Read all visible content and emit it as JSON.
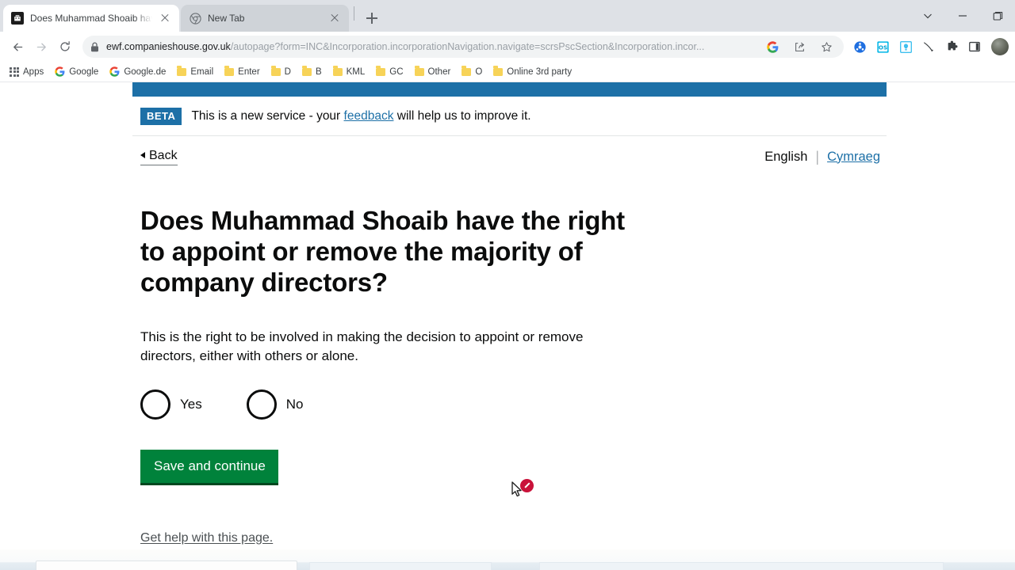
{
  "browser": {
    "tabs": [
      {
        "title": "Does Muhammad Shoaib have t",
        "favicon": "companies-house-icon",
        "active": true
      },
      {
        "title": "New Tab",
        "favicon": "chrome-icon",
        "active": false
      }
    ],
    "new_tab_label": "+",
    "window_controls": [
      "chevron-down-icon",
      "minimize-icon",
      "maximize-icon"
    ],
    "nav": {
      "back": "back-arrow-icon",
      "forward": "forward-arrow-icon",
      "reload": "reload-icon"
    },
    "omnibox": {
      "lock": "lock-icon",
      "url_domain": "ewf.companieshouse.gov.uk",
      "url_path": "/autopage?form=INC&Incorporation.incorporationNavigation.navigate=scrsPscSection&Incorporation.incor...",
      "actions": [
        "google-icon",
        "share-icon",
        "bookmark-star-icon"
      ]
    },
    "extensions": [
      "blue-circle-extension-icon",
      "os-extension-icon",
      "bulb-extension-icon",
      "pen-extension-icon",
      "puzzle-extensions-icon",
      "side-panel-icon"
    ],
    "profile": "avatar",
    "bookmarks": [
      {
        "label": "Apps",
        "icon": "apps-grid-icon"
      },
      {
        "label": "Google",
        "icon": "google-icon"
      },
      {
        "label": "Google.de",
        "icon": "google-icon"
      },
      {
        "label": "Email",
        "icon": "folder-icon"
      },
      {
        "label": "Enter",
        "icon": "folder-icon"
      },
      {
        "label": "D",
        "icon": "folder-icon"
      },
      {
        "label": "B",
        "icon": "folder-icon"
      },
      {
        "label": "KML",
        "icon": "folder-icon"
      },
      {
        "label": "GC",
        "icon": "folder-icon"
      },
      {
        "label": "Other",
        "icon": "folder-icon"
      },
      {
        "label": "O",
        "icon": "folder-icon"
      },
      {
        "label": "Online 3rd party",
        "icon": "folder-icon"
      }
    ]
  },
  "page": {
    "phase_banner": {
      "tag": "BETA",
      "text_before": "This is a new service - your ",
      "link": "feedback",
      "text_after": " will help us to improve it."
    },
    "back_link": "Back",
    "language": {
      "current": "English",
      "separator": "|",
      "alternate": "Cymraeg"
    },
    "heading": "Does Muhammad Shoaib have the right to appoint or remove the majority of company directors?",
    "hint": "This is the right to be involved in making the decision to appoint or remove directors, either with others or alone.",
    "radios": [
      {
        "label": "Yes",
        "value": "yes",
        "checked": false
      },
      {
        "label": "No",
        "value": "no",
        "checked": false
      }
    ],
    "submit_label": "Save and continue",
    "help_link": "Get help with this page.",
    "colors": {
      "gov_blue": "#1d70a7",
      "button_green": "#00823b",
      "button_green_shadow": "#00481f",
      "link_blue": "#1d70a7",
      "text": "#0b0c0c"
    }
  }
}
